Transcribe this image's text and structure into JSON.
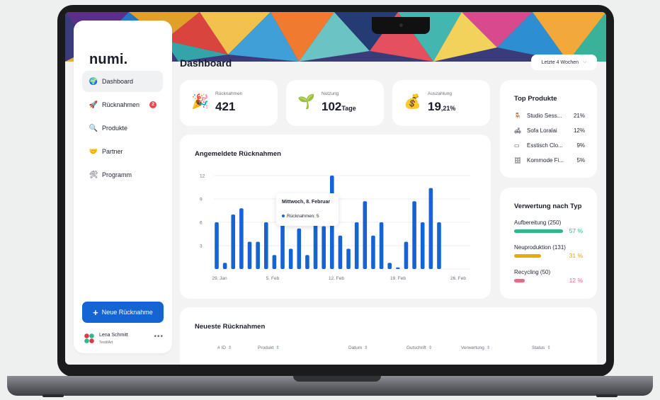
{
  "app": {
    "logo": "numi.",
    "page_title": "Dashboard"
  },
  "date_range": {
    "label": "Letzte 4 Wochen",
    "icon": "chevron-down-icon"
  },
  "sidebar": {
    "items": [
      {
        "label": "Dashboard",
        "icon": "globe-icon",
        "glyph": "🌍",
        "active": true
      },
      {
        "label": "Rücknahmen",
        "icon": "rocket-icon",
        "glyph": "🚀",
        "badge": "2"
      },
      {
        "label": "Produkte",
        "icon": "magnifier-icon",
        "glyph": "🔍"
      },
      {
        "label": "Partner",
        "icon": "handshake-icon",
        "glyph": "🤝"
      },
      {
        "label": "Programm",
        "icon": "tools-icon",
        "glyph": "🛠"
      }
    ],
    "cta_label": "Neue Rücknahme",
    "user": {
      "name": "Lena Schmitt",
      "company": "TextilArt"
    }
  },
  "stats": [
    {
      "label": "Rücknahmen",
      "value": "421",
      "suffix": "",
      "icon": "party-popper-icon",
      "glyph": "🎉"
    },
    {
      "label": "Nutzung",
      "value": "102",
      "suffix": "Tage",
      "icon": "seedling-icon",
      "glyph": "🌱"
    },
    {
      "label": "Auszahlung",
      "value": "19",
      "suffix": ",21%",
      "icon": "money-bag-icon",
      "glyph": "💰"
    }
  ],
  "top_products": {
    "title": "Top Produkte",
    "items": [
      {
        "name": "Studio Sess...",
        "pct": "21%",
        "icon": "chair-icon",
        "glyph": "🪑"
      },
      {
        "name": "Sofa Loralai",
        "pct": "12%",
        "icon": "sofa-icon",
        "glyph": "🛋"
      },
      {
        "name": "Esstisch Clo...",
        "pct": "9%",
        "icon": "table-icon",
        "glyph": "▭"
      },
      {
        "name": "Kommode Fi...",
        "pct": "5%",
        "icon": "dresser-icon",
        "glyph": "🗄"
      }
    ]
  },
  "verwertung": {
    "title": "Verwertung nach Typ",
    "items": [
      {
        "label": "Aufbereitung (250)",
        "pct": "57 %",
        "fraction": 0.57,
        "color": "#2fb68a"
      },
      {
        "label": "Neuproduktion (131)",
        "pct": "31 %",
        "fraction": 0.31,
        "color": "#e8a90c"
      },
      {
        "label": "Recycling (50)",
        "pct": "12 %",
        "fraction": 0.12,
        "color": "#e56a83"
      }
    ]
  },
  "chart_data": {
    "type": "bar",
    "title": "Angemeldete Rücknahmen",
    "x_tick_labels": [
      "29. Jan",
      "5. Feb",
      "12. Feb",
      "19. Feb",
      "26. Feb"
    ],
    "y_ticks": [
      3,
      6,
      9,
      12
    ],
    "ylim": [
      0,
      12
    ],
    "grid": true,
    "values": [
      6,
      0.8,
      7,
      7.8,
      3.5,
      3.5,
      6,
      1.8,
      7,
      2.6,
      5.2,
      1.8,
      8,
      5.5,
      12,
      4.3,
      2.6,
      6,
      8.7,
      4.3,
      6,
      0.8,
      0.2,
      3.5,
      8.7,
      6,
      10.4,
      6
    ],
    "color": "#1464d4",
    "tooltip": {
      "title": "Mittwoch, 8. Februar",
      "label": "Rücknahmen: 5"
    }
  },
  "table": {
    "title": "Neueste Rücknahmen",
    "columns": [
      "# ID",
      "Produkt",
      "Datum",
      "Gutschrift",
      "Verwertung",
      "Status"
    ]
  }
}
